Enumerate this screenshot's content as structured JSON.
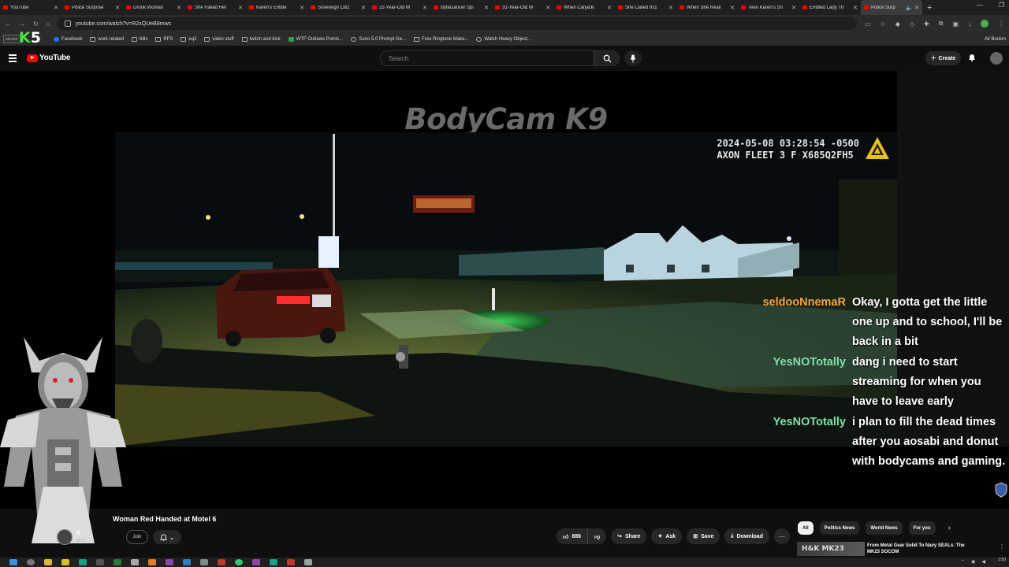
{
  "browser": {
    "tabs": [
      {
        "label": "YouTube"
      },
      {
        "label": "Police Surprise"
      },
      {
        "label": "Drunk Woman"
      },
      {
        "label": "She Faked Her"
      },
      {
        "label": "Karen's Entitle"
      },
      {
        "label": "Sovereign Citiz"
      },
      {
        "label": "22-Year-Old W"
      },
      {
        "label": "ByteDancer Spi"
      },
      {
        "label": "31-Year-Old W"
      },
      {
        "label": "When Carjacki"
      },
      {
        "label": "She Called 911"
      },
      {
        "label": "When She Reali"
      },
      {
        "label": "Teen Karen's Sh"
      },
      {
        "label": "Entitled Lady Th"
      },
      {
        "label": "Police Surp"
      }
    ],
    "url": "youtube.com/watch?v=R2xQUeB8mws",
    "bookmarks": [
      {
        "label": "Facebook",
        "icon": "facebook-icon"
      },
      {
        "label": "work related",
        "icon": "folder-icon"
      },
      {
        "label": "bills",
        "icon": "folder-icon"
      },
      {
        "label": "RFS",
        "icon": "folder-icon"
      },
      {
        "label": "eq2",
        "icon": "folder-icon"
      },
      {
        "label": "video stuff",
        "icon": "folder-icon"
      },
      {
        "label": "twitch and kick",
        "icon": "folder-icon"
      },
      {
        "label": "WTF Outlaws Points...",
        "icon": "plus-icon"
      },
      {
        "label": "Suno 5.0 Prompt Ge...",
        "icon": "globe-icon"
      },
      {
        "label": "Free Ringtone Make...",
        "icon": "page-icon"
      },
      {
        "label": "Watch Heavy Object...",
        "icon": "globe-icon"
      }
    ],
    "all_bookmarks": "All Bookm",
    "stream_logo": "stream",
    "overlay_logo": {
      "k": "K",
      "five": "5"
    }
  },
  "youtube": {
    "logo_text": "YouTube",
    "search_placeholder": "Search",
    "create_label": "Create"
  },
  "video": {
    "watermark": "BodyCam K9",
    "timestamp_line1": "2024-05-08 03:28:54 -0500",
    "timestamp_line2": "AXON FLEET 3 F X685Q2FH5",
    "title": "Woman Red Handed at Motel 6",
    "channel_initial": "B",
    "subs": "16.3",
    "join_label": "Join",
    "like_count": "886",
    "share_label": "Share",
    "ask_label": "Ask",
    "save_label": "Save",
    "download_label": "Download"
  },
  "chat": [
    {
      "user": "seldooNnemaR",
      "color": "#f0a33c",
      "text": "Okay, I gotta get the little one up and to school, I'll be back in a bit"
    },
    {
      "user": "YesNOTotally",
      "color": "#7ee0a7",
      "text": "dang i need to start streaming for when you have to leave early"
    },
    {
      "user": "YesNOTotally",
      "color": "#7ee0a7",
      "text": "i plan to fill the dead times after you aosabi and donut with bodycams and gaming."
    }
  ],
  "chips": [
    "All",
    "Politics News",
    "World News",
    "For you"
  ],
  "recommendation": {
    "thumb_text": "H&K MK23",
    "title": "From Metal Gear Solid To Navy SEALs: The MK23 SOCOM"
  },
  "taskbar": {
    "time": "3:50"
  }
}
